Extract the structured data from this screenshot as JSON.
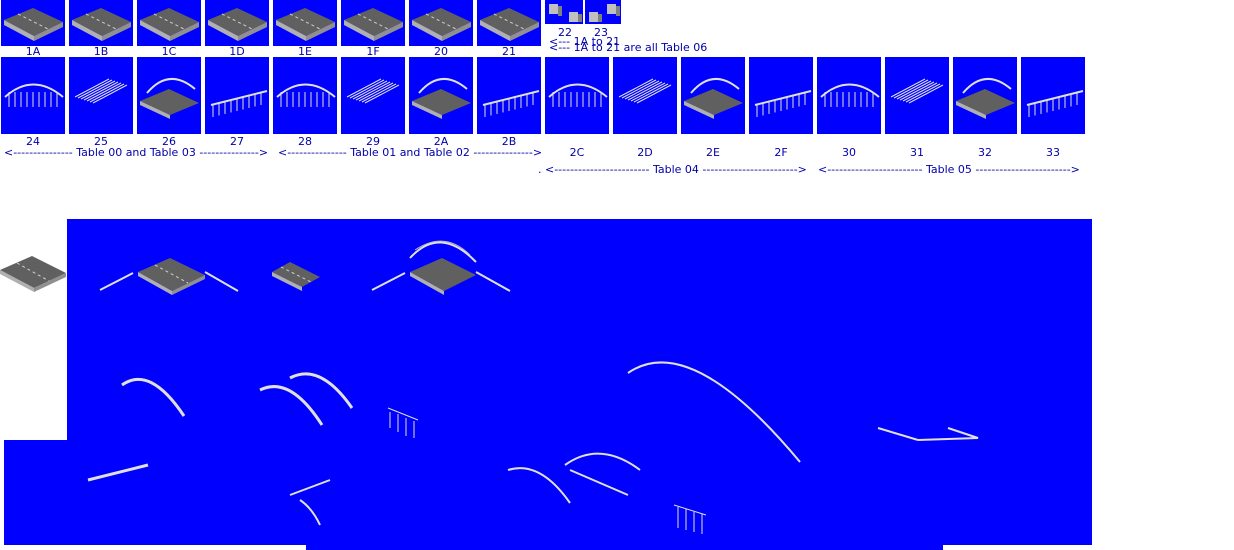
{
  "row1_labels": [
    "1A",
    "1B",
    "1C",
    "1D",
    "1E",
    "1F",
    "20",
    "21"
  ],
  "row1_small_labels": [
    "22",
    "23"
  ],
  "row1_note_back": "<--- 1A to 21",
  "row1_note": "<--- 1A to 21 are all Table 06",
  "row2_labels": [
    "24",
    "25",
    "26",
    "27",
    "28",
    "29",
    "2A",
    "2B",
    "2C",
    "2D",
    "2E",
    "2F",
    "30",
    "31",
    "32",
    "33"
  ],
  "table_labels": {
    "t0003": "<--------------- Table 00 and Table 03 --------------->",
    "t0102": "<--------------- Table 01 and Table 02 --------------->",
    "t04": ". <------------------------ Table 04 ------------------------>",
    "t05": "<------------------------ Table 05 ------------------------>"
  },
  "colors": {
    "tile_bg": "#0000ff",
    "label_text": "#0000aa",
    "road_gray": "#808080",
    "rail_light": "#e0e0e0"
  }
}
